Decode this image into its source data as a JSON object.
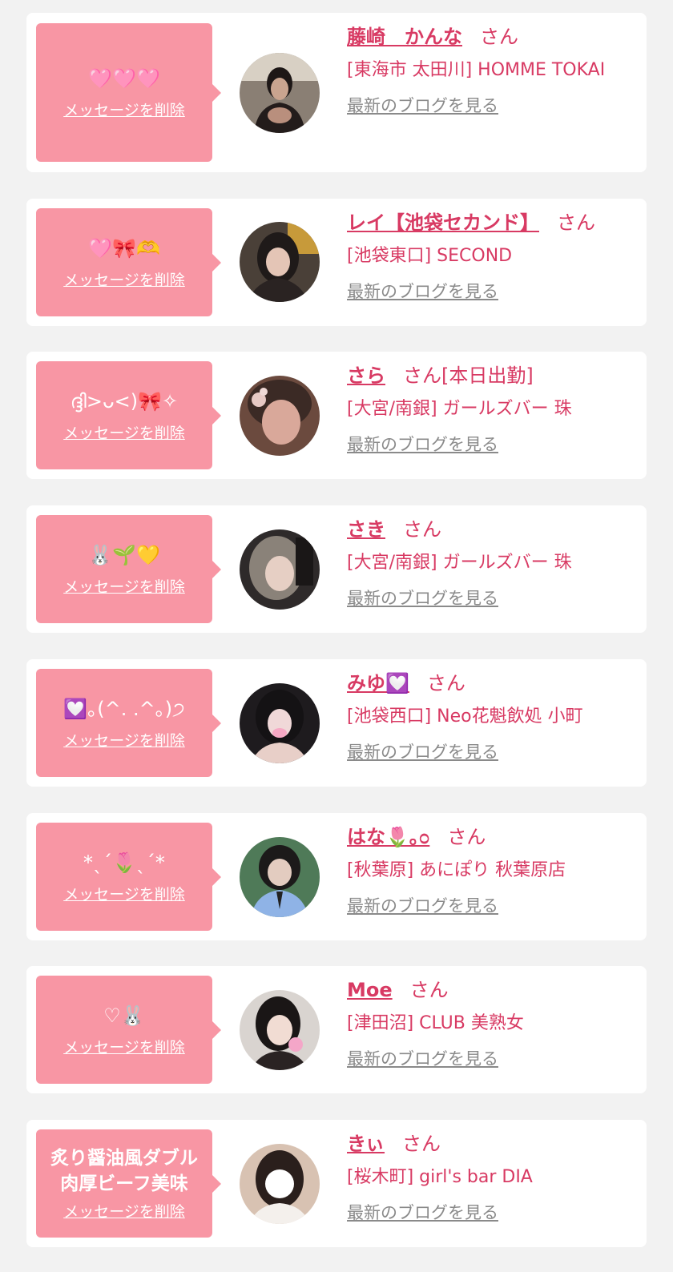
{
  "common": {
    "delete_label": "メッセージを削除",
    "blog_label": "最新のブログを見る"
  },
  "colors": {
    "page_bg": "#f2f2f2",
    "bubble_pink": "#f896a4",
    "name_accent": "#d83a63",
    "link_gray": "#8a8a8a"
  },
  "cards": [
    {
      "message": "🩷🩷🩷",
      "name": "藤崎　かんな",
      "suffix": "さん",
      "shop": "[東海市 太田川] HOMME TOKAI"
    },
    {
      "message": "🩷🎀🫶",
      "name": "レイ【池袋セカンド】",
      "suffix": "さん",
      "shop": "[池袋東口] SECOND"
    },
    {
      "message": "ദ്ദി>ᴗ<)🎀✧",
      "name": "さら",
      "suffix": "さん[本日出勤]",
      "shop": "[大宮/南銀] ガールズバー 珠"
    },
    {
      "message": "🐰🌱💛",
      "name": "さき",
      "suffix": "さん",
      "shop": "[大宮/南銀] ガールズバー 珠"
    },
    {
      "message": "💟｡(^. .^｡)੭",
      "name": "みゆ💟",
      "suffix": "さん",
      "shop": "[池袋西口] Neo花魁飲処 小町"
    },
    {
      "message": "*ˎˊ🌷ˎˊ*",
      "name": "はな🌷｡೦",
      "suffix": "さん",
      "shop": "[秋葉原] あにぽり 秋葉原店"
    },
    {
      "message": "♡🐰",
      "name": "Moe",
      "suffix": "さん",
      "shop": "[津田沼] CLUB 美熟女"
    },
    {
      "message": "炙り醤油風ダブル肉厚ビーフ美味",
      "name": "きぃ",
      "suffix": "さん",
      "shop": "[桜木町] girl's bar DIA"
    }
  ]
}
